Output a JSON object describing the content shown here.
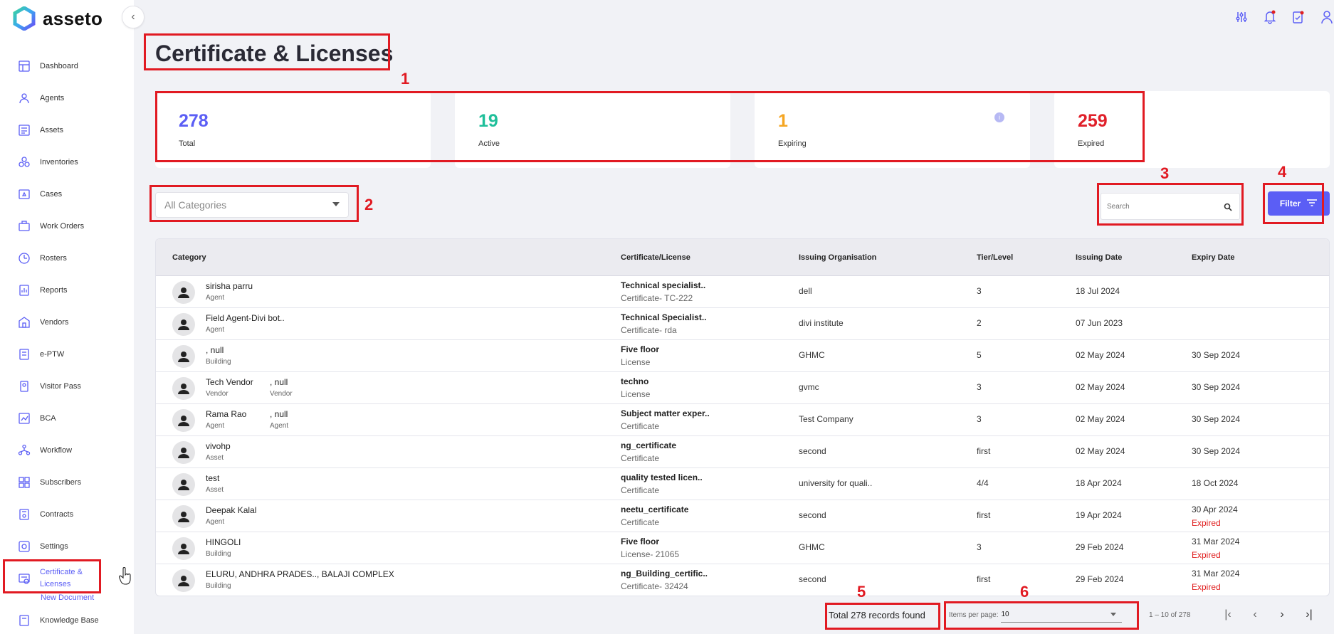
{
  "app": {
    "name": "asseto"
  },
  "sidebar": {
    "items": [
      {
        "label": "Dashboard",
        "icon": "dashboard-icon"
      },
      {
        "label": "Agents",
        "icon": "agents-icon"
      },
      {
        "label": "Assets",
        "icon": "assets-icon"
      },
      {
        "label": "Inventories",
        "icon": "inventories-icon"
      },
      {
        "label": "Cases",
        "icon": "cases-icon"
      },
      {
        "label": "Work Orders",
        "icon": "work-orders-icon"
      },
      {
        "label": "Rosters",
        "icon": "rosters-icon"
      },
      {
        "label": "Reports",
        "icon": "reports-icon"
      },
      {
        "label": "Vendors",
        "icon": "vendors-icon"
      },
      {
        "label": "e-PTW",
        "icon": "eptw-icon"
      },
      {
        "label": "Visitor Pass",
        "icon": "visitor-pass-icon"
      },
      {
        "label": "BCA",
        "icon": "bca-icon"
      },
      {
        "label": "Workflow",
        "icon": "workflow-icon"
      },
      {
        "label": "Subscribers",
        "icon": "subscribers-icon"
      },
      {
        "label": "Contracts",
        "icon": "contracts-icon"
      },
      {
        "label": "Settings",
        "icon": "settings-icon"
      },
      {
        "label": "Certificate &",
        "label2": "Licenses",
        "icon": "certificate-icon"
      }
    ],
    "sub_item": "New Document",
    "last_item": "Knowledge Base"
  },
  "page": {
    "title": "Certificate & Licenses"
  },
  "stats": [
    {
      "value": "278",
      "label": "Total",
      "color": "#5b5ef5"
    },
    {
      "value": "19",
      "label": "Active",
      "color": "#1fbf9a"
    },
    {
      "value": "1",
      "label": "Expiring",
      "color": "#f5a623"
    },
    {
      "value": "259",
      "label": "Expired",
      "color": "#e0202a"
    }
  ],
  "controls": {
    "category_select": "All Categories",
    "search_placeholder": "Search",
    "filter_label": "Filter"
  },
  "table": {
    "headers": [
      "Category",
      "Certificate/License",
      "Issuing Organisation",
      "Tier/Level",
      "Issuing Date",
      "Expiry Date"
    ],
    "rows": [
      {
        "name": "sirisha parru",
        "type": "Agent",
        "name2": "",
        "type2": "",
        "cert": "Technical specialist..",
        "cert_sub": "Certificate- TC-222",
        "org": "dell",
        "tier": "3",
        "issue": "18 Jul 2024",
        "expiry": "",
        "status": ""
      },
      {
        "name": "Field Agent-Divi bot..",
        "type": "Agent",
        "name2": "",
        "type2": "",
        "cert": "Technical Specialist..",
        "cert_sub": "Certificate- rda",
        "org": "divi institute",
        "tier": "2",
        "issue": "07 Jun 2023",
        "expiry": "",
        "status": ""
      },
      {
        "name": ", null",
        "type": "Building",
        "name2": "",
        "type2": "",
        "cert": "Five floor",
        "cert_sub": "License",
        "org": "GHMC",
        "tier": "5",
        "issue": "02 May 2024",
        "expiry": "30 Sep 2024",
        "status": ""
      },
      {
        "name": "Tech Vendor",
        "type": "Vendor",
        "name2": ", null",
        "type2": "Vendor",
        "cert": "techno",
        "cert_sub": "License",
        "org": "gvmc",
        "tier": "3",
        "issue": "02 May 2024",
        "expiry": "30 Sep 2024",
        "status": ""
      },
      {
        "name": "Rama Rao",
        "type": "Agent",
        "name2": ", null",
        "type2": "Agent",
        "cert": "Subject matter exper..",
        "cert_sub": "Certificate",
        "org": "Test Company",
        "tier": "3",
        "issue": "02 May 2024",
        "expiry": "30 Sep 2024",
        "status": ""
      },
      {
        "name": "vivohp",
        "type": "Asset",
        "name2": "",
        "type2": "",
        "cert": "ng_certificate",
        "cert_sub": "Certificate",
        "org": "second",
        "tier": "first",
        "issue": "02 May 2024",
        "expiry": "30 Sep 2024",
        "status": ""
      },
      {
        "name": "test",
        "type": "Asset",
        "name2": "",
        "type2": "",
        "cert": "quality tested licen..",
        "cert_sub": "Certificate",
        "org": "university for quali..",
        "tier": "4/4",
        "issue": "18 Apr 2024",
        "expiry": "18 Oct 2024",
        "status": ""
      },
      {
        "name": "Deepak Kalal",
        "type": "Agent",
        "name2": "",
        "type2": "",
        "cert": "neetu_certificate",
        "cert_sub": "Certificate",
        "org": "second",
        "tier": "first",
        "issue": "19 Apr 2024",
        "expiry": "30 Apr 2024",
        "status": "Expired"
      },
      {
        "name": "HINGOLI",
        "type": "Building",
        "name2": "",
        "type2": "",
        "cert": "Five floor",
        "cert_sub": "License- 21065",
        "org": "GHMC",
        "tier": "3",
        "issue": "29 Feb 2024",
        "expiry": "31 Mar 2024",
        "status": "Expired"
      },
      {
        "name": "ELURU, ANDHRA PRADES.., BALAJI COMPLEX",
        "type": "Building",
        "name2": "",
        "type2": "",
        "cert": "ng_Building_certific..",
        "cert_sub": "Certificate- 32424",
        "org": "second",
        "tier": "first",
        "issue": "29 Feb 2024",
        "expiry": "31 Mar 2024",
        "status": "Expired"
      }
    ]
  },
  "footer": {
    "records": "Total 278 records found",
    "items_per_page_label": "Items per page:",
    "items_per_page_value": "10",
    "range": "1 – 10 of 278"
  },
  "annotations": [
    "1",
    "2",
    "3",
    "4",
    "5",
    "6"
  ]
}
